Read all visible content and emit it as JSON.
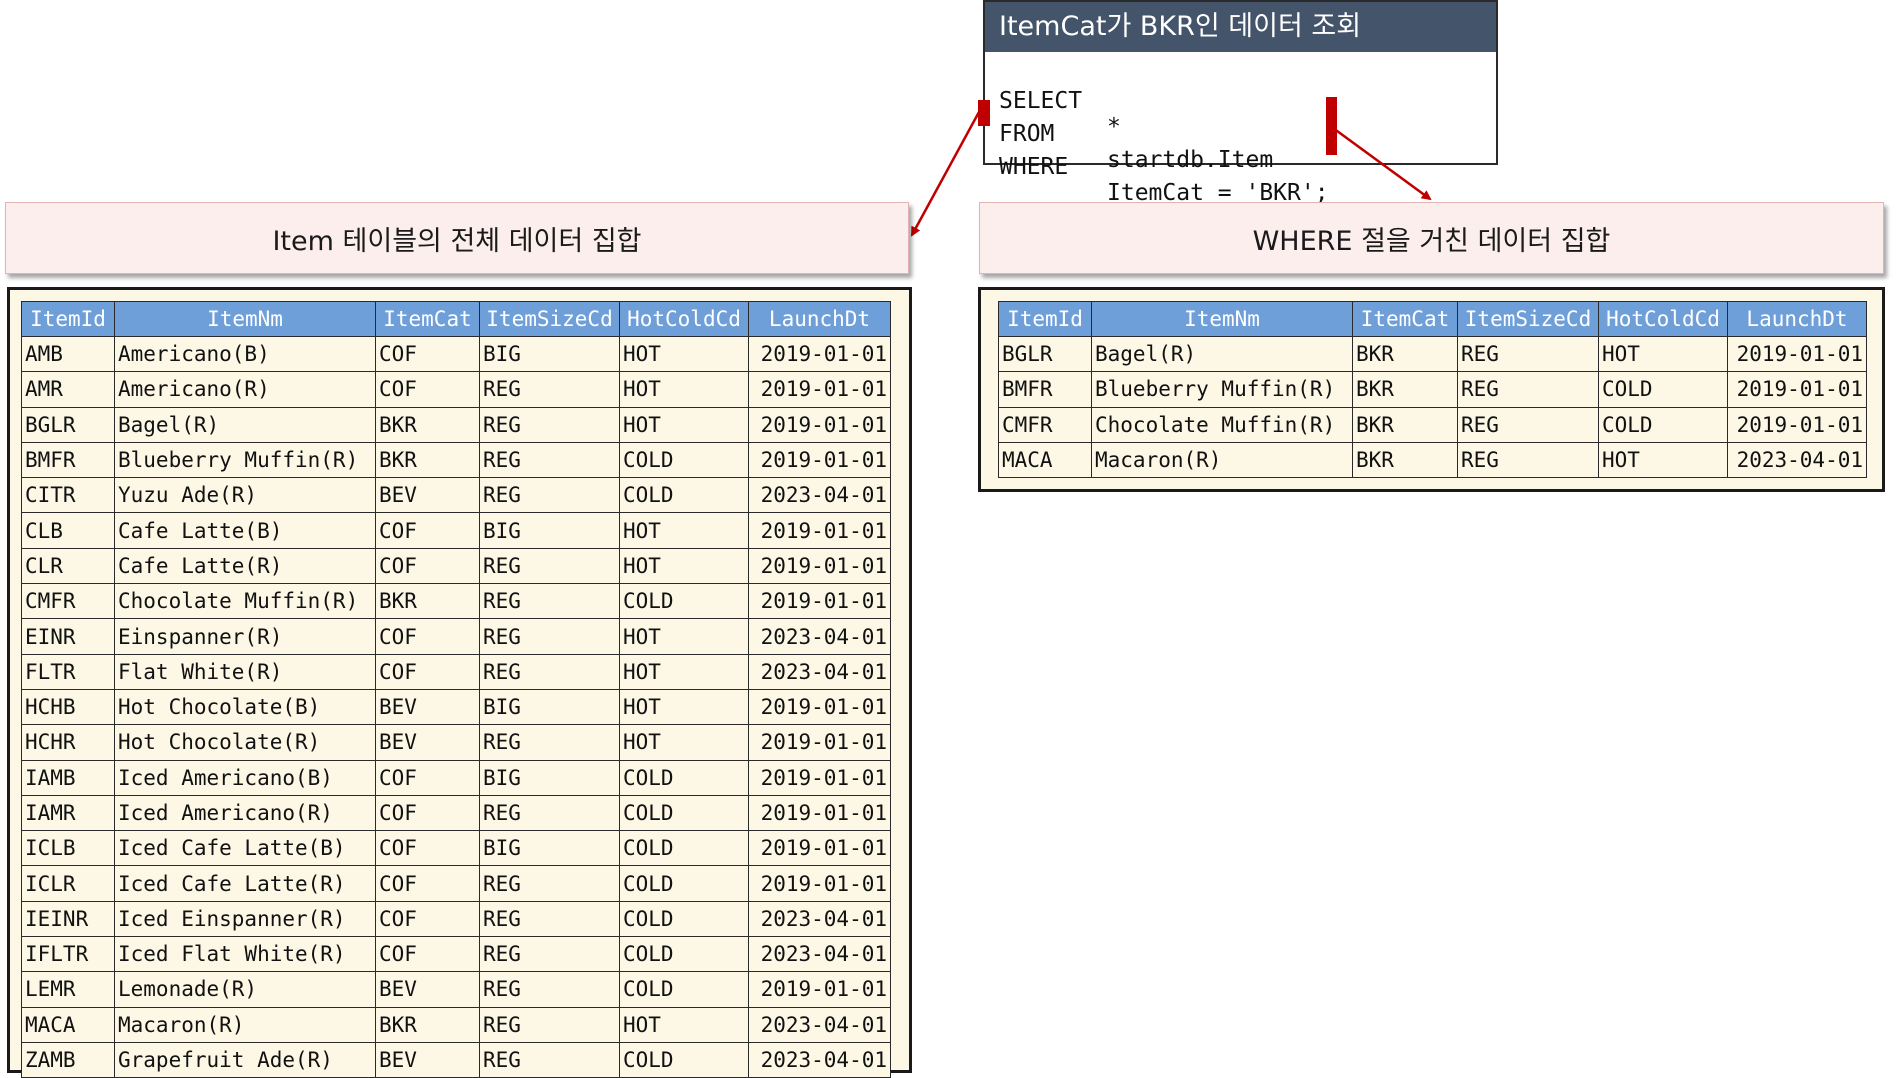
{
  "query_box": {
    "title": "ItemCat가 BKR인 데이터 조회",
    "lines": [
      {
        "keyword": "SELECT",
        "arg": "*"
      },
      {
        "keyword": "FROM",
        "arg": "startdb.Item"
      },
      {
        "keyword": "WHERE",
        "arg": "ItemCat = 'BKR';"
      }
    ]
  },
  "left_panel": {
    "header": "Item 테이블의 전체 데이터 집합",
    "columns": [
      "ItemId",
      "ItemNm",
      "ItemCat",
      "ItemSizeCd",
      "HotColdCd",
      "LaunchDt"
    ],
    "rows": [
      [
        "AMB",
        "Americano(B)",
        "COF",
        "BIG",
        "HOT",
        "2019-01-01"
      ],
      [
        "AMR",
        "Americano(R)",
        "COF",
        "REG",
        "HOT",
        "2019-01-01"
      ],
      [
        "BGLR",
        "Bagel(R)",
        "BKR",
        "REG",
        "HOT",
        "2019-01-01"
      ],
      [
        "BMFR",
        "Blueberry Muffin(R)",
        "BKR",
        "REG",
        "COLD",
        "2019-01-01"
      ],
      [
        "CITR",
        "Yuzu Ade(R)",
        "BEV",
        "REG",
        "COLD",
        "2023-04-01"
      ],
      [
        "CLB",
        "Cafe Latte(B)",
        "COF",
        "BIG",
        "HOT",
        "2019-01-01"
      ],
      [
        "CLR",
        "Cafe Latte(R)",
        "COF",
        "REG",
        "HOT",
        "2019-01-01"
      ],
      [
        "CMFR",
        "Chocolate Muffin(R)",
        "BKR",
        "REG",
        "COLD",
        "2019-01-01"
      ],
      [
        "EINR",
        "Einspanner(R)",
        "COF",
        "REG",
        "HOT",
        "2023-04-01"
      ],
      [
        "FLTR",
        "Flat White(R)",
        "COF",
        "REG",
        "HOT",
        "2023-04-01"
      ],
      [
        "HCHB",
        "Hot Chocolate(B)",
        "BEV",
        "BIG",
        "HOT",
        "2019-01-01"
      ],
      [
        "HCHR",
        "Hot Chocolate(R)",
        "BEV",
        "REG",
        "HOT",
        "2019-01-01"
      ],
      [
        "IAMB",
        "Iced Americano(B)",
        "COF",
        "BIG",
        "COLD",
        "2019-01-01"
      ],
      [
        "IAMR",
        "Iced Americano(R)",
        "COF",
        "REG",
        "COLD",
        "2019-01-01"
      ],
      [
        "ICLB",
        "Iced Cafe Latte(B)",
        "COF",
        "BIG",
        "COLD",
        "2019-01-01"
      ],
      [
        "ICLR",
        "Iced Cafe Latte(R)",
        "COF",
        "REG",
        "COLD",
        "2019-01-01"
      ],
      [
        "IEINR",
        "Iced Einspanner(R)",
        "COF",
        "REG",
        "COLD",
        "2023-04-01"
      ],
      [
        "IFLTR",
        "Iced Flat White(R)",
        "COF",
        "REG",
        "COLD",
        "2023-04-01"
      ],
      [
        "LEMR",
        "Lemonade(R)",
        "BEV",
        "REG",
        "COLD",
        "2019-01-01"
      ],
      [
        "MACA",
        "Macaron(R)",
        "BKR",
        "REG",
        "HOT",
        "2023-04-01"
      ],
      [
        "ZAMB",
        "Grapefruit Ade(R)",
        "BEV",
        "REG",
        "COLD",
        "2023-04-01"
      ]
    ]
  },
  "right_panel": {
    "header": "WHERE 절을 거친 데이터 집합",
    "columns": [
      "ItemId",
      "ItemNm",
      "ItemCat",
      "ItemSizeCd",
      "HotColdCd",
      "LaunchDt"
    ],
    "rows": [
      [
        "BGLR",
        "Bagel(R)",
        "BKR",
        "REG",
        "HOT",
        "2019-01-01"
      ],
      [
        "BMFR",
        "Blueberry Muffin(R)",
        "BKR",
        "REG",
        "COLD",
        "2019-01-01"
      ],
      [
        "CMFR",
        "Chocolate Muffin(R)",
        "BKR",
        "REG",
        "COLD",
        "2019-01-01"
      ],
      [
        "MACA",
        "Macaron(R)",
        "BKR",
        "REG",
        "HOT",
        "2023-04-01"
      ]
    ]
  },
  "colors": {
    "header_bar": "#44546a",
    "table_header": "#6f9fd8",
    "table_body": "#fdf8e6",
    "arrow": "#c00000",
    "section_header_bg": "#fdeeee"
  }
}
